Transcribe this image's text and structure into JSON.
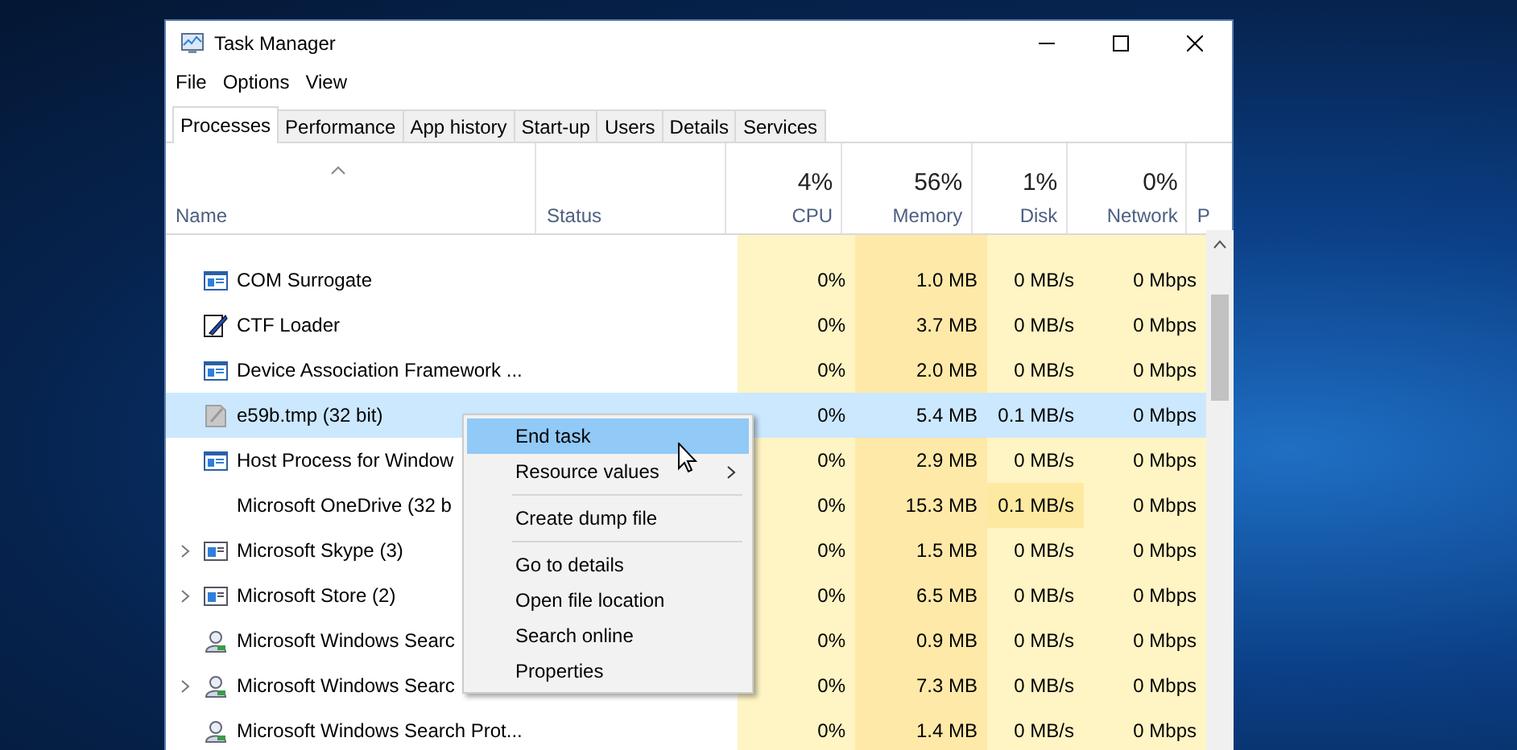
{
  "window": {
    "title": "Task Manager"
  },
  "menu": [
    "File",
    "Options",
    "View"
  ],
  "tabs": [
    {
      "label": "Processes",
      "selected": true
    },
    {
      "label": "Performance",
      "selected": false
    },
    {
      "label": "App history",
      "selected": false
    },
    {
      "label": "Start-up",
      "selected": false
    },
    {
      "label": "Users",
      "selected": false
    },
    {
      "label": "Details",
      "selected": false
    },
    {
      "label": "Services",
      "selected": false
    }
  ],
  "table": {
    "columns": [
      {
        "label": "Name"
      },
      {
        "label": "Status"
      },
      {
        "percent": "4%",
        "label": "CPU"
      },
      {
        "percent": "56%",
        "label": "Memory"
      },
      {
        "percent": "1%",
        "label": "Disk"
      },
      {
        "percent": "0%",
        "label": "Network"
      },
      {
        "label": "P"
      }
    ],
    "rows": [
      {
        "name": "COM Surrogate",
        "kind": "window",
        "expandable": false,
        "selected": false,
        "disk_hot": false,
        "cpu": "0%",
        "memory": "1.0 MB",
        "disk": "0 MB/s",
        "network": "0 Mbps"
      },
      {
        "name": "CTF Loader",
        "kind": "pen",
        "expandable": false,
        "selected": false,
        "disk_hot": false,
        "cpu": "0%",
        "memory": "3.7 MB",
        "disk": "0 MB/s",
        "network": "0 Mbps"
      },
      {
        "name": "Device Association Framework ...",
        "kind": "window",
        "expandable": false,
        "selected": false,
        "disk_hot": false,
        "cpu": "0%",
        "memory": "2.0 MB",
        "disk": "0 MB/s",
        "network": "0 Mbps"
      },
      {
        "name": "e59b.tmp (32 bit)",
        "kind": "file",
        "expandable": false,
        "selected": true,
        "disk_hot": false,
        "cpu": "0%",
        "memory": "5.4 MB",
        "disk": "0.1 MB/s",
        "network": "0 Mbps"
      },
      {
        "name": "Host Process for Window",
        "kind": "window",
        "expandable": false,
        "selected": false,
        "disk_hot": false,
        "cpu": "0%",
        "memory": "2.9 MB",
        "disk": "0 MB/s",
        "network": "0 Mbps"
      },
      {
        "name": "Microsoft OneDrive (32 b",
        "kind": "plain",
        "expandable": false,
        "selected": false,
        "disk_hot": true,
        "cpu": "0%",
        "memory": "15.3 MB",
        "disk": "0.1 MB/s",
        "network": "0 Mbps"
      },
      {
        "name": "Microsoft Skype (3)",
        "kind": "app",
        "expandable": true,
        "selected": false,
        "disk_hot": false,
        "cpu": "0%",
        "memory": "1.5 MB",
        "disk": "0 MB/s",
        "network": "0 Mbps"
      },
      {
        "name": "Microsoft Store (2)",
        "kind": "app",
        "expandable": true,
        "selected": false,
        "disk_hot": false,
        "cpu": "0%",
        "memory": "6.5 MB",
        "disk": "0 MB/s",
        "network": "0 Mbps"
      },
      {
        "name": "Microsoft Windows Searc",
        "kind": "search",
        "expandable": false,
        "selected": false,
        "disk_hot": false,
        "cpu": "0%",
        "memory": "0.9 MB",
        "disk": "0 MB/s",
        "network": "0 Mbps"
      },
      {
        "name": "Microsoft Windows Searc",
        "kind": "search",
        "expandable": true,
        "selected": false,
        "disk_hot": false,
        "cpu": "0%",
        "memory": "7.3 MB",
        "disk": "0 MB/s",
        "network": "0 Mbps"
      },
      {
        "name": "Microsoft Windows Search Prot...",
        "kind": "search",
        "expandable": false,
        "selected": false,
        "disk_hot": false,
        "cpu": "0%",
        "memory": "1.4 MB",
        "disk": "0 MB/s",
        "network": "0 Mbps"
      }
    ]
  },
  "context_menu": {
    "items": [
      {
        "kind": "item",
        "label": "End task",
        "selected": true,
        "submenu": false
      },
      {
        "kind": "item",
        "label": "Resource values",
        "selected": false,
        "submenu": true
      },
      {
        "kind": "separator"
      },
      {
        "kind": "item",
        "label": "Create dump file",
        "selected": false,
        "submenu": false
      },
      {
        "kind": "separator"
      },
      {
        "kind": "item",
        "label": "Go to details",
        "selected": false,
        "submenu": false
      },
      {
        "kind": "item",
        "label": "Open file location",
        "selected": false,
        "submenu": false
      },
      {
        "kind": "item",
        "label": "Search online",
        "selected": false,
        "submenu": false
      },
      {
        "kind": "item",
        "label": "Properties",
        "selected": false,
        "submenu": false
      }
    ]
  }
}
